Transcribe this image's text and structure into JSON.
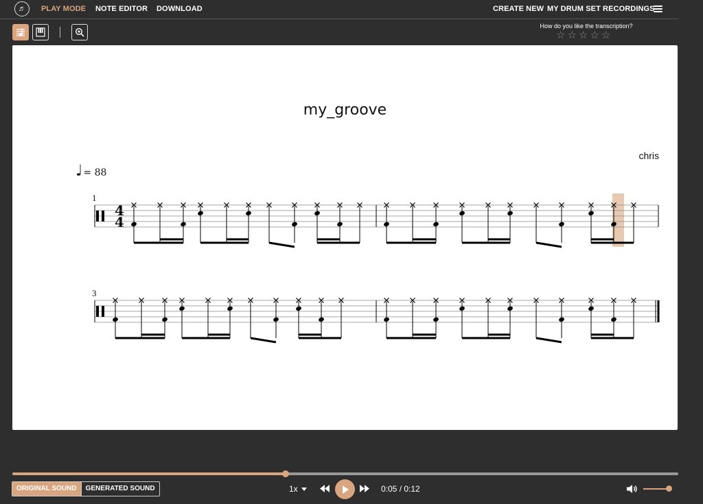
{
  "nav": {
    "logo_symbol": "♬",
    "play_mode": "PLAY MODE",
    "note_editor": "NOTE EDITOR",
    "download": "DOWNLOAD",
    "create_new": "CREATE NEW",
    "recordings": "MY DRUM SET RECORDINGS"
  },
  "toolbar": {
    "icons": [
      "score-view-icon",
      "piano-roll-icon",
      "zoom-in-icon"
    ]
  },
  "rating": {
    "question": "How do you like the transcription?",
    "max_stars": 5,
    "current": 0
  },
  "score": {
    "title": "my_groove",
    "composer": "chris",
    "tempo_symbol": "♩",
    "tempo_value": "= 88",
    "time_signature_top": "4",
    "time_signature_bottom": "4",
    "system1_measure": "1",
    "system2_measure": "3"
  },
  "player": {
    "original_sound": "ORIGINAL SOUND",
    "generated_sound": "GENERATED SOUND",
    "speed": "1x",
    "current_time": "0:05",
    "total_time": "0:12",
    "time_display": "0:05 / 0:12",
    "progress_fraction": 0.41,
    "volume_fraction": 1.0
  },
  "colors": {
    "accent": "#d9a57f",
    "background": "#2e2e2e",
    "sheet": "#ffffff"
  }
}
